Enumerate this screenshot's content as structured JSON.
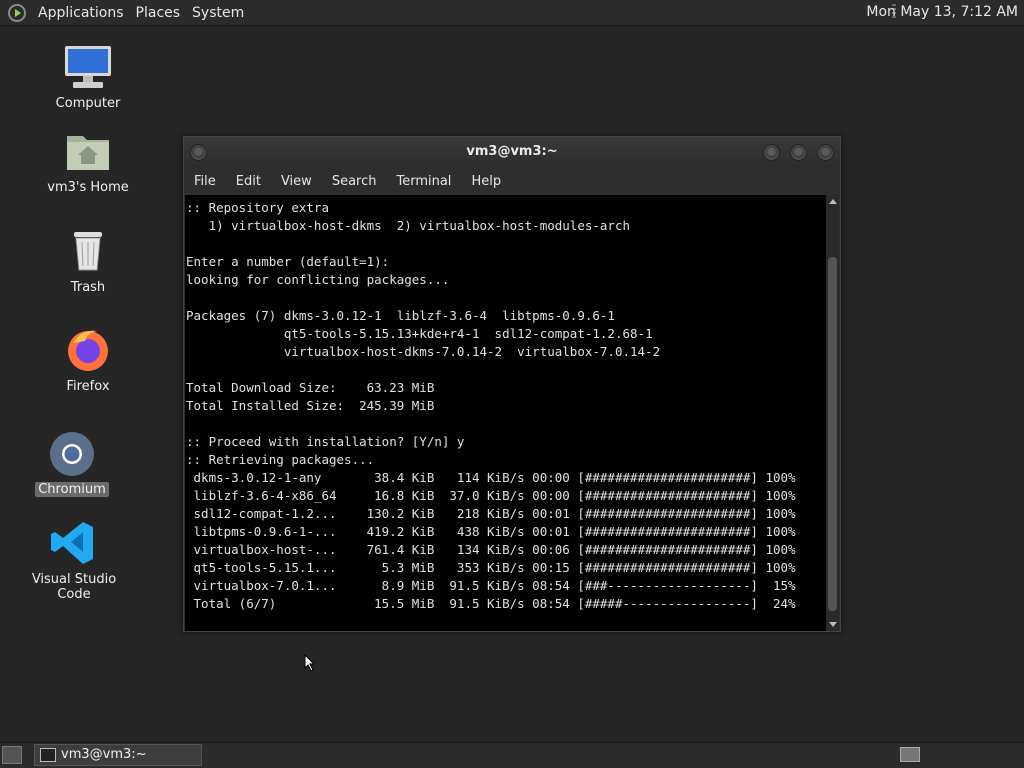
{
  "top_panel": {
    "menus": [
      "Applications",
      "Places",
      "System"
    ],
    "clock": "Mon May 13,  7:12 AM"
  },
  "desktop": {
    "icons": [
      {
        "label": "Computer",
        "icon": "computer-icon"
      },
      {
        "label": "vm3's Home",
        "icon": "home-folder-icon"
      },
      {
        "label": "Trash",
        "icon": "trash-icon"
      },
      {
        "label": "Firefox",
        "icon": "firefox-icon"
      },
      {
        "label": "Chromium",
        "icon": "chromium-icon"
      },
      {
        "label": "Visual Studio Code",
        "icon": "vscode-icon"
      }
    ]
  },
  "terminal": {
    "title": "vm3@vm3:~",
    "menus": [
      "File",
      "Edit",
      "View",
      "Search",
      "Terminal",
      "Help"
    ],
    "lines": [
      ":: Repository extra",
      "   1) virtualbox-host-dkms  2) virtualbox-host-modules-arch",
      "",
      "Enter a number (default=1):",
      "looking for conflicting packages...",
      "",
      "Packages (7) dkms-3.0.12-1  liblzf-3.6-4  libtpms-0.9.6-1",
      "             qt5-tools-5.15.13+kde+r4-1  sdl12-compat-1.2.68-1",
      "             virtualbox-host-dkms-7.0.14-2  virtualbox-7.0.14-2",
      "",
      "Total Download Size:    63.23 MiB",
      "Total Installed Size:  245.39 MiB",
      "",
      ":: Proceed with installation? [Y/n] y",
      ":: Retrieving packages...",
      " dkms-3.0.12-1-any       38.4 KiB   114 KiB/s 00:00 [######################] 100%",
      " liblzf-3.6-4-x86_64     16.8 KiB  37.0 KiB/s 00:00 [######################] 100%",
      " sdl12-compat-1.2...    130.2 KiB   218 KiB/s 00:01 [######################] 100%",
      " libtpms-0.9.6-1-...    419.2 KiB   438 KiB/s 00:01 [######################] 100%",
      " virtualbox-host-...    761.4 KiB   134 KiB/s 00:06 [######################] 100%",
      " qt5-tools-5.15.1...      5.3 MiB   353 KiB/s 00:15 [######################] 100%",
      " virtualbox-7.0.1...      8.9 MiB  91.5 KiB/s 08:54 [###-------------------]  15%",
      " Total (6/7)             15.5 MiB  91.5 KiB/s 08:54 [#####-----------------]  24%"
    ]
  },
  "bottom_panel": {
    "task_label": "vm3@vm3:~"
  }
}
